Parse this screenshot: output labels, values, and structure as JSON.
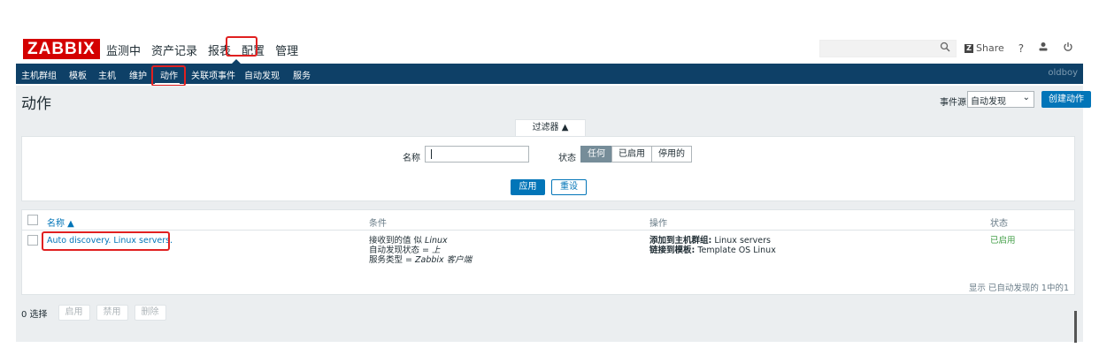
{
  "header": {
    "logo": "ZABBIX",
    "menu": [
      "监测中",
      "资产记录",
      "报表",
      "配置",
      "管理"
    ],
    "share_label": "Share",
    "help_icon": "?",
    "user_icon": "user-icon",
    "power_icon": "power-icon"
  },
  "subnav": {
    "items": [
      "主机群组",
      "模板",
      "主机",
      "维护",
      "动作",
      "关联项事件",
      "自动发现",
      "服务"
    ],
    "active": "动作",
    "user": "oldboy"
  },
  "page": {
    "title": "动作",
    "event_source_label": "事件源",
    "event_source_value": "自动发现",
    "create_button": "创建动作"
  },
  "filter": {
    "tab_label": "过滤器 ▲",
    "name_label": "名称",
    "name_value": "",
    "status_label": "状态",
    "status_options": [
      "任何",
      "已启用",
      "停用的"
    ],
    "status_selected": "任何",
    "apply_label": "应用",
    "reset_label": "重设"
  },
  "table": {
    "columns": [
      "名称 ▲",
      "条件",
      "操作",
      "状态"
    ],
    "rows": [
      {
        "name": "Auto discovery. Linux servers.",
        "conditions": [
          {
            "key": "接收到的值 似 ",
            "val": "Linux"
          },
          {
            "key": "自动发现状态 = ",
            "val": "上"
          },
          {
            "key": "服务类型 = ",
            "val": "Zabbix 客户端"
          }
        ],
        "operations": [
          {
            "key": "添加到主机群组:",
            "val": " Linux servers"
          },
          {
            "key": "链接到模板:",
            "val": " Template OS Linux"
          }
        ],
        "status": "已启用"
      }
    ],
    "footer": "显示 已自动发现的 1中的1"
  },
  "mass_actions": {
    "selected": "0 选择",
    "buttons": [
      "启用",
      "禁用",
      "删除"
    ]
  },
  "colors": {
    "brand_red": "#d40000",
    "nav_blue": "#0e4067",
    "accent_blue": "#0275b8",
    "enabled_green": "#429e47",
    "highlight_red": "#e02020"
  }
}
